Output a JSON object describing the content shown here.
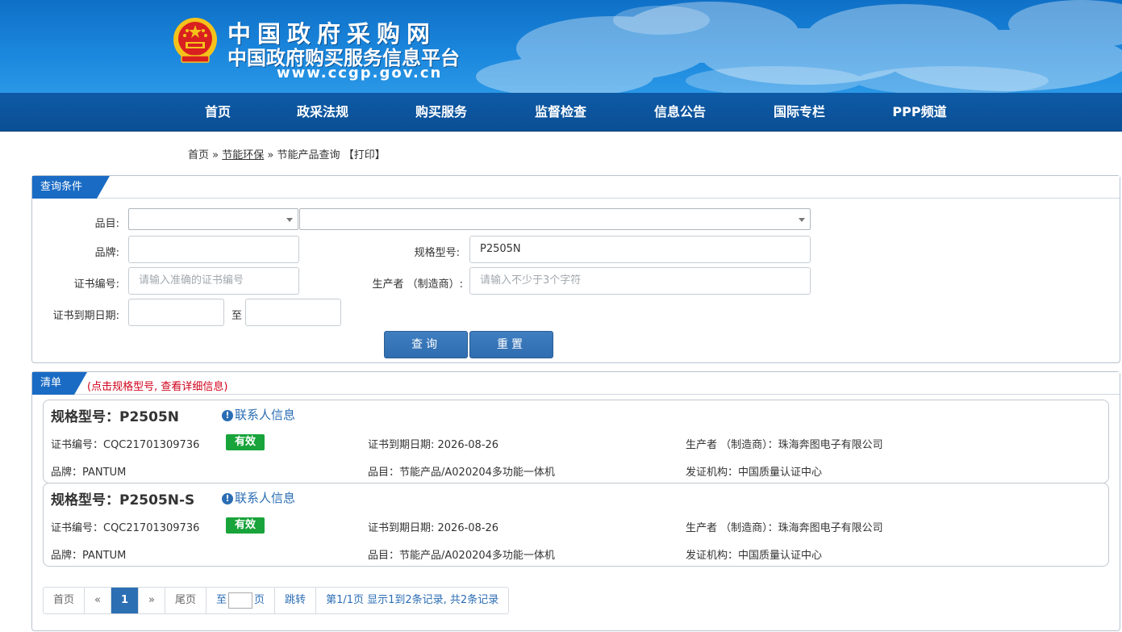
{
  "header": {
    "logo_cn1": "中国政府采购网",
    "logo_cn2": "中国政府购买服务信息平台",
    "logo_url": "www.ccgp.gov.cn"
  },
  "nav": {
    "items": [
      "首页",
      "政采法规",
      "购买服务",
      "监督检查",
      "信息公告",
      "国际专栏",
      "PPP频道"
    ]
  },
  "breadcrumb": {
    "home": "首页",
    "sep": "»",
    "section": "节能环保",
    "page": "节能产品查询",
    "print": "【打印】"
  },
  "query": {
    "tab_label": "查询条件",
    "category_label": "品目:",
    "category_value_1": "",
    "category_value_2": "",
    "brand_label": "品牌:",
    "brand_value": "",
    "model_label": "规格型号:",
    "model_value": "P2505N",
    "cert_label": "证书编号:",
    "cert_placeholder": "请输入准确的证书编号",
    "maker_label": "生产者 （制造商）:",
    "maker_placeholder": "请输入不少于3个字符",
    "expiry_label": "证书到期日期:",
    "expiry_to": "至",
    "expiry_from_value": "",
    "expiry_to_value": "",
    "search_button": "查询",
    "reset_button": "重置"
  },
  "results": {
    "tab_label": "清单",
    "hint": "(点击规格型号, 查看详细信息)",
    "contact_label": "联系人信息",
    "items": [
      {
        "model": "规格型号：P2505N",
        "cert": "证书编号：CQC21701309736",
        "status": "有效",
        "expiry": "证书到期日期: 2026-08-26",
        "maker": "生产者 （制造商）：珠海奔图电子有限公司",
        "brand": "品牌：PANTUM",
        "category": "品目：节能产品/A020204多功能一体机",
        "issuer": "发证机构：中国质量认证中心"
      },
      {
        "model": "规格型号：P2505N-S",
        "cert": "证书编号：CQC21701309736",
        "status": "有效",
        "expiry": "证书到期日期: 2026-08-26",
        "maker": "生产者 （制造商）：珠海奔图电子有限公司",
        "brand": "品牌：PANTUM",
        "category": "品目：节能产品/A020204多功能一体机",
        "issuer": "发证机构：中国质量认证中心"
      }
    ]
  },
  "pagination": {
    "first": "首页",
    "prev": "«",
    "current": "1",
    "next": "»",
    "last": "尾页",
    "goto_prefix": "至",
    "goto_suffix": "页",
    "jump": "跳转",
    "summary": "第1/1页  显示1到2条记录, 共2条记录"
  },
  "colors": {
    "banner": "#1a86dc",
    "nav": "#0e5aa6",
    "panel_tab": "#1a6bc4",
    "button": "#2f6db0",
    "status_valid": "#18a43a",
    "hint": "#d0021b",
    "link": "#2a6db4"
  },
  "icons": [
    "national-emblem-icon",
    "exclamation-circle-icon",
    "dropdown-arrow-icon"
  ]
}
